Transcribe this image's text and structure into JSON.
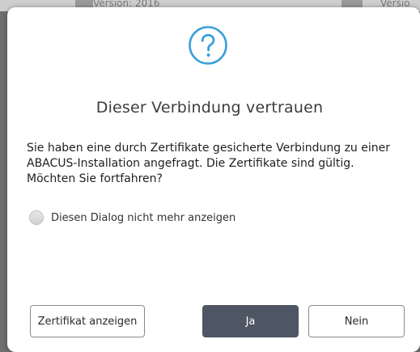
{
  "background": {
    "label_left": "Version: 2016",
    "label_right": "Versio"
  },
  "dialog": {
    "icon": "question-circle-icon",
    "title": "Dieser Verbindung vertrauen",
    "message": "Sie haben eine durch Zertifikate gesicherte Verbindung zu einer ABACUS-Installation angefragt. Die Zertifikate sind gültig. Möchten Sie fortfahren?",
    "dont_show_again": {
      "label": "Diesen Dialog nicht mehr anzeigen",
      "checked": false
    },
    "buttons": {
      "show_certificate": "Zertifikat anzeigen",
      "yes": "Ja",
      "no": "Nein"
    }
  },
  "colors": {
    "accent": "#3aa0dc",
    "primary_button": "#4e5563"
  }
}
